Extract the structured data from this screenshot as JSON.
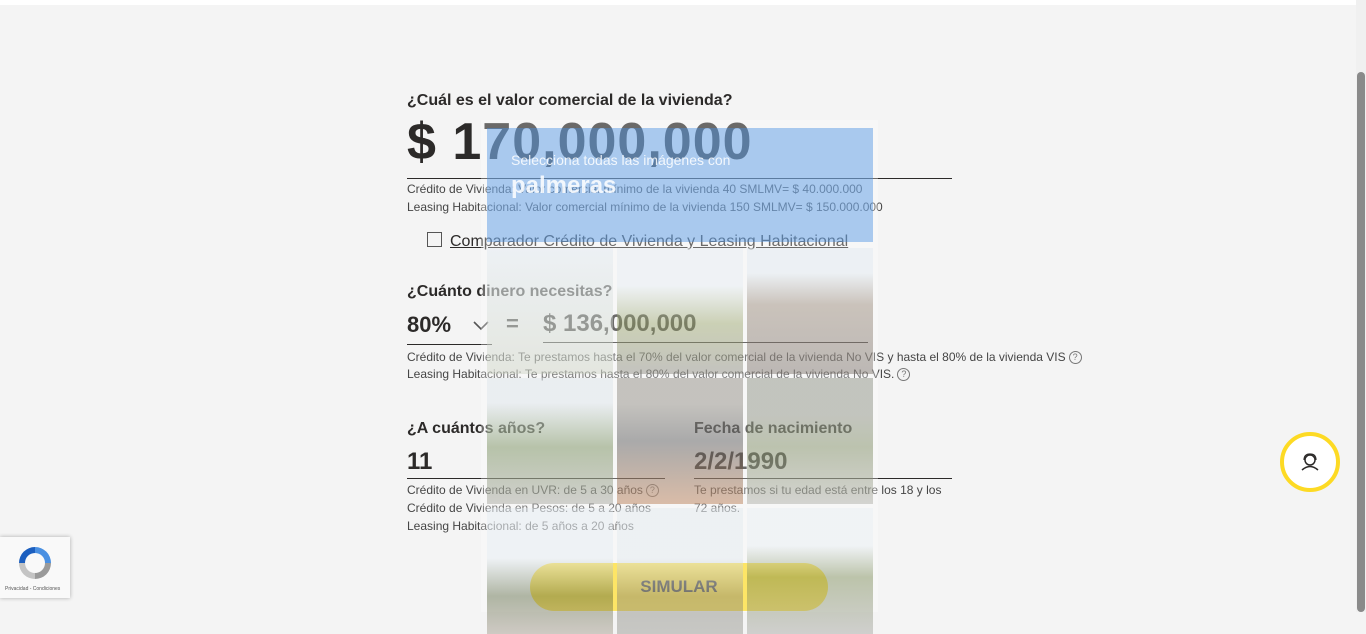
{
  "form": {
    "q_value": "¿Cuál es el valor comercial de la vivienda?",
    "value": "$ 170,000,000",
    "value_note_1": "Crédito de Vivienda: Valor comercial mínimo de la vivienda 40 SMLMV= $ 40.000.000",
    "value_note_2": "Leasing Habitacional: Valor comercial mínimo de la vivienda 150 SMLMV= $ 150.000.000",
    "compare_link": "Comparador Crédito de Vivienda y Leasing Habitacional",
    "q_money": "¿Cuánto dinero necesitas?",
    "percent": "80%",
    "equals": "=",
    "money": "$ 136,000,000",
    "money_note_1": "Crédito de Vivienda: Te prestamos hasta el 70% del valor comercial de la vivienda No VIS y hasta el 80% de la vivienda VIS",
    "money_note_2": "Leasing Habitacional: Te prestamos hasta el 80% del valor comercial de la vivienda No VIS.",
    "q_years": "¿A cuántos años?",
    "years": "11",
    "years_note_1": "Crédito de Vivienda en UVR: de 5 a 30 años",
    "years_note_2": "Crédito de Vivienda en Pesos: de 5 a 20 años",
    "years_note_3": "Leasing Habitacional: de 5 años a 20 años",
    "q_birth": "Fecha de nacimiento",
    "birth": "2/2/1990",
    "birth_note": "Te prestamos si tu edad está entre los 18 y los 72 años.",
    "simulate": "SIMULAR"
  },
  "help_glyph": "?",
  "captcha": {
    "instruction": "Selecciona todas las imágenes con",
    "target": "palmeras"
  },
  "recaptcha": {
    "label": "Privacidad - Condiciones"
  },
  "colors": {
    "accent": "#fdda24",
    "text": "#2c2a29",
    "captcha_header": "#4a90e2"
  },
  "icons": [
    "external-link-icon",
    "chevron-down-icon",
    "help-icon",
    "advisor-icon",
    "recaptcha-icon"
  ]
}
